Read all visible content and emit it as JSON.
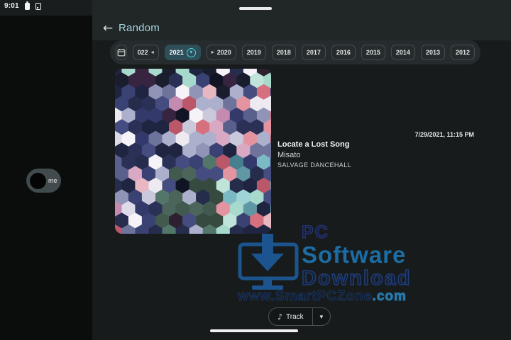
{
  "status_bar": {
    "time": "9:01"
  },
  "header": {
    "title": "Random"
  },
  "icons": {
    "back": "←",
    "music_note": "♪",
    "chevron_down": "▾",
    "left_triangle": "◂",
    "right_triangle": "▸"
  },
  "year_filter": {
    "chips": [
      {
        "label": "022",
        "suffix_icon": "left-triangle"
      },
      {
        "label": "2021",
        "selected": true,
        "suffix_icon": "chevron-down-circle"
      },
      {
        "label": "2020",
        "prefix_icon": "right-triangle"
      },
      {
        "label": "2019"
      },
      {
        "label": "2018"
      },
      {
        "label": "2017"
      },
      {
        "label": "2016"
      },
      {
        "label": "2015"
      },
      {
        "label": "2014"
      },
      {
        "label": "2013"
      },
      {
        "label": "2012"
      }
    ]
  },
  "track": {
    "date": "7/29/2021, 11:15 PM",
    "title": "Locate a Lost Song",
    "artist": "Misato",
    "album": "SALVAGE DANCEHALL"
  },
  "bubble": {
    "label": "me"
  },
  "footer": {
    "track_button_label": "Track"
  },
  "watermark": {
    "pc": "PC",
    "software": "Software",
    "download": "Download",
    "www": "www.SmartPCZone",
    "com": ".com"
  },
  "colors": {
    "accent_cyan": "#4fd2e4",
    "title_cyan": "#a7d4e0",
    "selected_chip_bg": "#2e4f59",
    "watermark_blue": "#1d5c9f",
    "panel_bg": "#171b1b",
    "header_bg": "#212727",
    "chips_bar_bg": "#262c2d"
  },
  "album_art": {
    "seed": 20210729,
    "palette": {
      "navy": [
        "#2b3156",
        "#262c4c",
        "#3a4273",
        "#1f2540",
        "#333a6b",
        "#454c80"
      ],
      "light": [
        "#edebf1",
        "#f5f3f7",
        "#dddbe8",
        "#cac9dc"
      ],
      "lavender": [
        "#adb0cd",
        "#9094b7",
        "#6e739c",
        "#5a608c"
      ],
      "pink": [
        "#d9a9c3",
        "#c48aaf",
        "#e394a0",
        "#d6707f",
        "#ba5769",
        "#e8b8c2"
      ],
      "dark": [
        "#1a1d2e",
        "#2d2031",
        "#111424",
        "#372440"
      ],
      "green": [
        "#41594f",
        "#4c655a",
        "#364a40",
        "#53766b"
      ],
      "teal": [
        "#6097a5",
        "#7bb9c5",
        "#9fd5d7",
        "#487f8f"
      ],
      "mint": [
        "#c0e4d9",
        "#a7d9cd"
      ]
    }
  }
}
